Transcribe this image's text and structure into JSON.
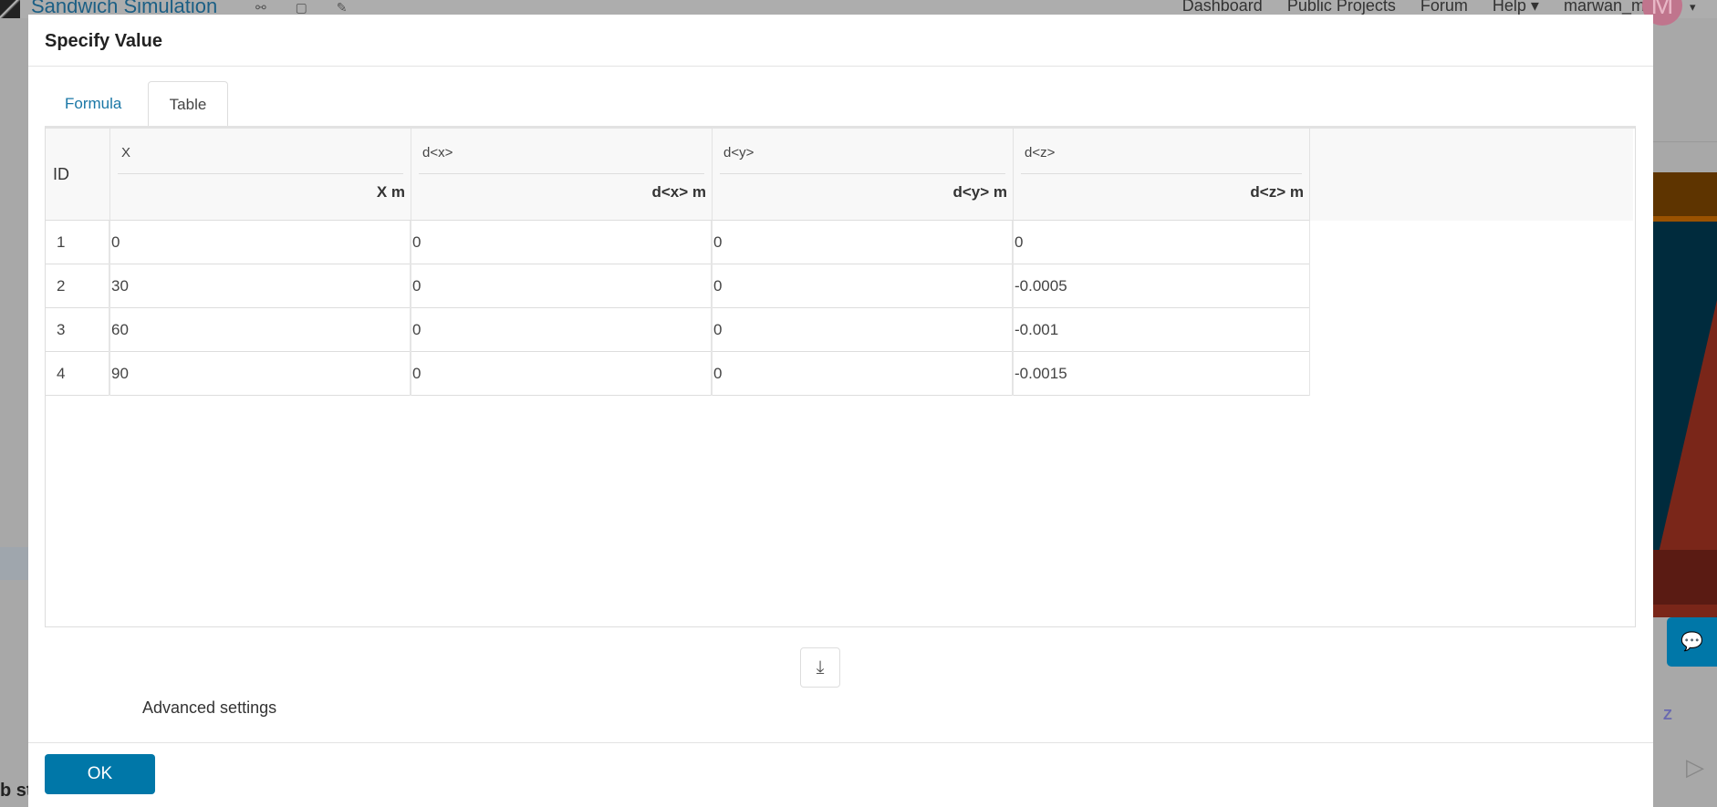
{
  "app": {
    "title": "Sandwich Simulation",
    "nav": [
      "Dashboard",
      "Public Projects",
      "Forum",
      "Help ▾",
      "marwan_mcn"
    ],
    "avatar_letter": "M",
    "partial_text": "b st"
  },
  "dialog": {
    "title": "Specify Value",
    "tabs": [
      {
        "label": "Formula",
        "active": false
      },
      {
        "label": "Table",
        "active": true
      }
    ],
    "table": {
      "id_header": "ID",
      "columns": [
        {
          "name": "X",
          "unit": "X m"
        },
        {
          "name": "d<x>",
          "unit": "d<x> m"
        },
        {
          "name": "d<y>",
          "unit": "d<y> m"
        },
        {
          "name": "d<z>",
          "unit": "d<z> m"
        }
      ],
      "rows": [
        [
          "1",
          "0",
          "0",
          "0",
          "0"
        ],
        [
          "2",
          "30",
          "0",
          "0",
          "-0.0005"
        ],
        [
          "3",
          "60",
          "0",
          "0",
          "-0.001"
        ],
        [
          "4",
          "90",
          "0",
          "0",
          "-0.0015"
        ]
      ]
    },
    "advanced_label": "Advanced settings",
    "ok_label": "OK"
  },
  "viewport": {
    "axis_label": "Z"
  },
  "colors": {
    "accent": "#0077a8",
    "overlay": "#a8a8a8"
  }
}
